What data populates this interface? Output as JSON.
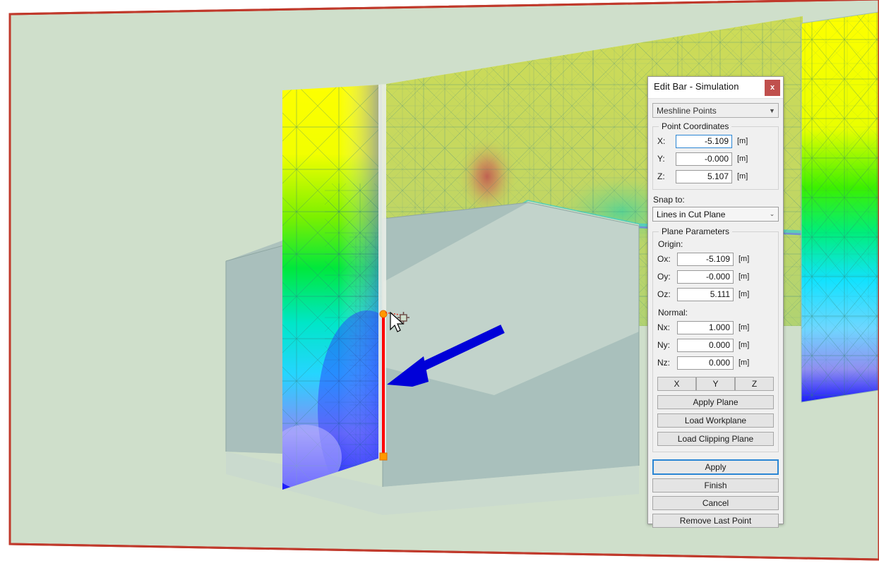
{
  "viewport": {
    "name": "3d-simulation-viewport",
    "scene": {
      "description": "CFD/FEA simulation of airflow around a gabled house with a vertical cut plane showing a rainbow colour field, plus a red-outlined clipping plane and a blue wind-direction arrow",
      "background_color": "#ffffff",
      "clip_plane_fill": "#cfdfcb",
      "clip_plane_border": "#c0392b",
      "house_fill": "#a9c0bc",
      "house_fill_light": "#c3d4cb",
      "wind_arrow_color": "#0000d8",
      "bar_color": "#ff0000",
      "bar_point_color": "#ff9900",
      "cursor_label": "pointer",
      "snap_marker_label": "crosshair-snap"
    }
  },
  "dialog": {
    "title": "Edit Bar - Simulation",
    "close_label": "x",
    "mode_select": {
      "label": "Meshline Points",
      "arrow": "▼"
    },
    "point_coordinates": {
      "legend": "Point Coordinates",
      "fields": [
        {
          "label": "X:",
          "value": "-5.109",
          "unit": "[m]",
          "focused": true
        },
        {
          "label": "Y:",
          "value": "-0.000",
          "unit": "[m]",
          "focused": false
        },
        {
          "label": "Z:",
          "value": "5.107",
          "unit": "[m]",
          "focused": false
        }
      ]
    },
    "snap": {
      "label": "Snap to:",
      "value": "Lines in Cut Plane",
      "arrow": "⌄"
    },
    "plane_parameters": {
      "legend": "Plane Parameters",
      "origin_label": "Origin:",
      "origin_fields": [
        {
          "label": "Ox:",
          "value": "-5.109",
          "unit": "[m]"
        },
        {
          "label": "Oy:",
          "value": "-0.000",
          "unit": "[m]"
        },
        {
          "label": "Oz:",
          "value": "5.111",
          "unit": "[m]"
        }
      ],
      "normal_label": "Normal:",
      "normal_fields": [
        {
          "label": "Nx:",
          "value": "1.000",
          "unit": "[m]"
        },
        {
          "label": "Ny:",
          "value": "0.000",
          "unit": "[m]"
        },
        {
          "label": "Nz:",
          "value": "0.000",
          "unit": "[m]"
        }
      ],
      "axis_buttons": [
        {
          "label": "X"
        },
        {
          "label": "Y"
        },
        {
          "label": "Z"
        }
      ],
      "plane_buttons": [
        {
          "label": "Apply Plane"
        },
        {
          "label": "Load Workplane"
        },
        {
          "label": "Load Clipping Plane"
        }
      ]
    },
    "actions": [
      {
        "label": "Apply",
        "primary": true
      },
      {
        "label": "Finish",
        "primary": false
      },
      {
        "label": "Cancel",
        "primary": false
      },
      {
        "label": "Remove Last Point",
        "primary": false
      }
    ]
  }
}
